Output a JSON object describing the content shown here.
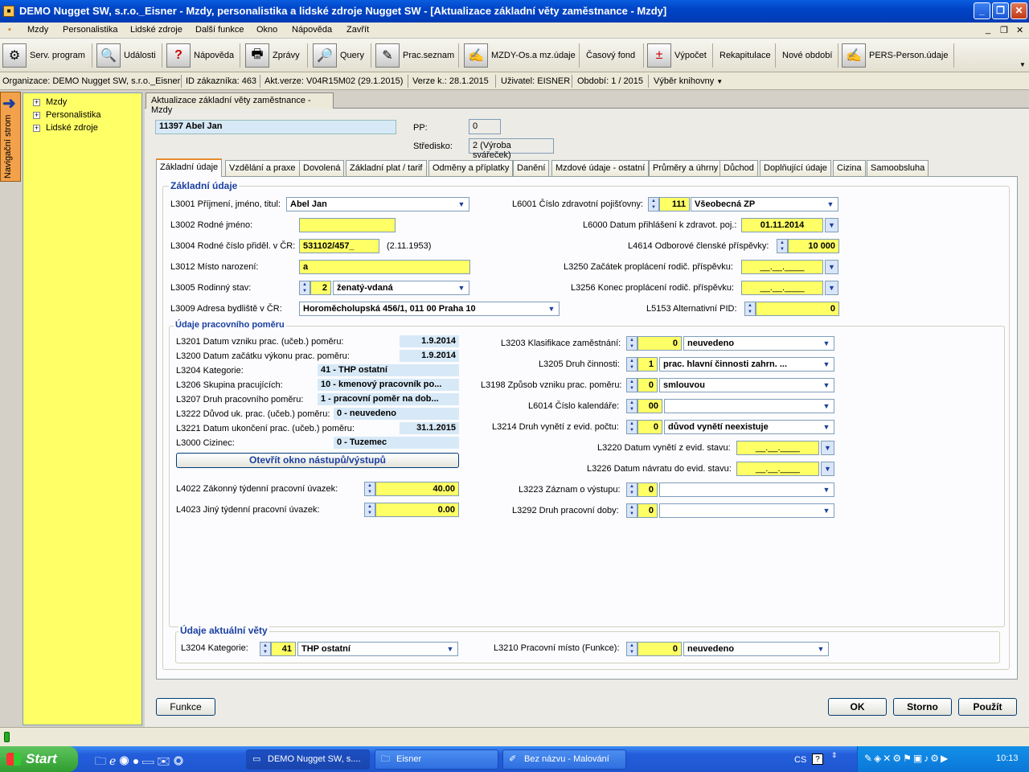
{
  "window": {
    "title": "DEMO Nugget SW, s.r.o._Eisner - Mzdy, personalistika a lidské zdroje Nugget SW - [Aktualizace základní věty zaměstnance - Mzdy]"
  },
  "menu": [
    "Mzdy",
    "Personalistika",
    "Lidské zdroje",
    "Další funkce",
    "Okno",
    "Nápověda",
    "Zavřít"
  ],
  "toolbar": [
    "Serv. program",
    "Události",
    "Nápověda",
    "Zprávy",
    "Query",
    "Prac.seznam",
    "MZDY-Os.a mz.údaje",
    "Časový fond",
    "Výpočet",
    "Rekapitulace",
    "Nové období",
    "PERS-Person.údaje"
  ],
  "info": {
    "org": "Organizace: DEMO Nugget SW, s.r.o._Eisner",
    "id": "ID zákazníka: 463",
    "akt": "Akt.verze: V04R15M02 (29.1.2015)",
    "verze": "Verze k.: 28.1.2015",
    "user": "Uživatel: EISNER",
    "obdobi": "Období: 1 / 2015",
    "knihovna": "Výběr knihovny"
  },
  "nav": {
    "strip": "Navigační strom",
    "items": [
      "Mzdy",
      "Personalistika",
      "Lidské zdroje"
    ]
  },
  "doc_tab": "Aktualizace základní věty zaměstnance - Mzdy",
  "employee": {
    "name": "11397   Abel Jan",
    "pp_label": "PP:",
    "pp": "0",
    "stredisko_label": "Středisko:",
    "stredisko": "2 (Výroba svářeček)"
  },
  "tabs": [
    "Základní údaje",
    "Vzdělání a praxe",
    "Dovolená",
    "Základní plat / tarif",
    "Odměny a příplatky",
    "Danění",
    "Mzdové údaje - ostatní",
    "Průměry a úhrny",
    "Důchod",
    "Doplňující údaje",
    "Cizina",
    "Samoobsluha"
  ],
  "zakladni": {
    "title": "Základní údaje",
    "l3001": "L3001 Příjmení, jméno, titul:",
    "l3001v": "Abel Jan",
    "l3002": "L3002 Rodné jméno:",
    "l3004": "L3004 Rodné číslo přiděl. v ČR:",
    "l3004v": "531102/457_",
    "l3004d": "(2.11.1953)",
    "l3012": "L3012 Místo narození:",
    "l3012v": "a",
    "l3005": "L3005 Rodinný stav:",
    "l3005n": "2",
    "l3005v": "ženatý-vdaná",
    "l3009": "L3009 Adresa bydliště v ČR:",
    "l3009v": "Horoměcholupská 456/1, 011 00  Praha 10",
    "l6001": "L6001 Číslo zdravotní pojišťovny:",
    "l6001n": "111",
    "l6001v": "Všeobecná ZP",
    "l6000": "L6000 Datum přihlášení k zdravot. poj.:",
    "l6000v": "01.11.2014",
    "l4614": "L4614 Odborové členské příspěvky:",
    "l4614v": "10 000",
    "l3250": "L3250 Začátek proplácení rodič. příspěvku:",
    "l3250v": "__.__.____",
    "l3256": "L3256 Konec proplácení rodič. příspěvku:",
    "l3256v": "__.__.____",
    "l5153": "L5153 Alternativní PID:",
    "l5153v": "0"
  },
  "pomer": {
    "title": "Údaje pracovního poměru",
    "l3201": "L3201 Datum vzniku prac. (učeb.) poměru:",
    "l3201v": "1.9.2014",
    "l3200": "L3200 Datum začátku výkonu prac. poměru:",
    "l3200v": "1.9.2014",
    "l3204": "L3204 Kategorie:",
    "l3204v": "41  - THP ostatní",
    "l3206": "L3206 Skupina pracujících:",
    "l3206v": "10  - kmenový pracovník po...",
    "l3207": "L3207 Druh pracovního poměru:",
    "l3207v": "1  - pracovní poměr na dob...",
    "l3222": "L3222 Důvod uk. prac. (učeb.) poměru:",
    "l3222v": "0  - neuvedeno",
    "l3221": "L3221 Datum ukončení prac. (učeb.) poměru:",
    "l3221v": "31.1.2015",
    "l3000": "L3000 Cizinec:",
    "l3000v": "0  - Tuzemec",
    "btn": "Otevřít okno nástupů/výstupů",
    "l4022": "L4022 Zákonný týdenní pracovní úvazek:",
    "l4022v": "40.00",
    "l4023": "L4023 Jiný týdenní pracovní úvazek:",
    "l4023v": "0.00",
    "l3203": "L3203 Klasifikace zaměstnání:",
    "l3203n": "0",
    "l3203v": "neuvedeno",
    "l3205": "L3205 Druh činnosti:",
    "l3205n": "1",
    "l3205v": "prac. hlavní činnosti   zahrn. ...",
    "l3198": "L3198 Způsob vzniku prac. poměru:",
    "l3198n": "0",
    "l3198v": "smlouvou",
    "l6014": "L6014 Číslo kalendáře:",
    "l6014n": "00",
    "l3214": "L3214 Druh vynětí z evid. počtu:",
    "l3214n": "0",
    "l3214v": "důvod vynětí neexistuje",
    "l3220": "L3220 Datum vynětí z evid. stavu:",
    "l3220v": "__.__.____",
    "l3226": "L3226 Datum návratu do evid. stavu:",
    "l3226v": "__.__.____",
    "l3223": "L3223 Záznam o výstupu:",
    "l3223n": "0",
    "l3292": "L3292 Druh pracovní doby:",
    "l3292n": "0"
  },
  "aktualni": {
    "title": "Údaje aktuální věty",
    "l3204": "L3204 Kategorie:",
    "l3204n": "41",
    "l3204v": "THP ostatní",
    "l3210": "L3210 Pracovní místo (Funkce):",
    "l3210n": "0",
    "l3210v": "neuvedeno"
  },
  "buttons": {
    "funkce": "Funkce",
    "ok": "OK",
    "storno": "Storno",
    "pouzit": "Použít"
  },
  "taskbar": {
    "start": "Start",
    "tasks": [
      "DEMO Nugget SW, s....",
      "Eisner",
      "Bez názvu - Malování"
    ],
    "lang": "CS",
    "time": "10:13"
  }
}
